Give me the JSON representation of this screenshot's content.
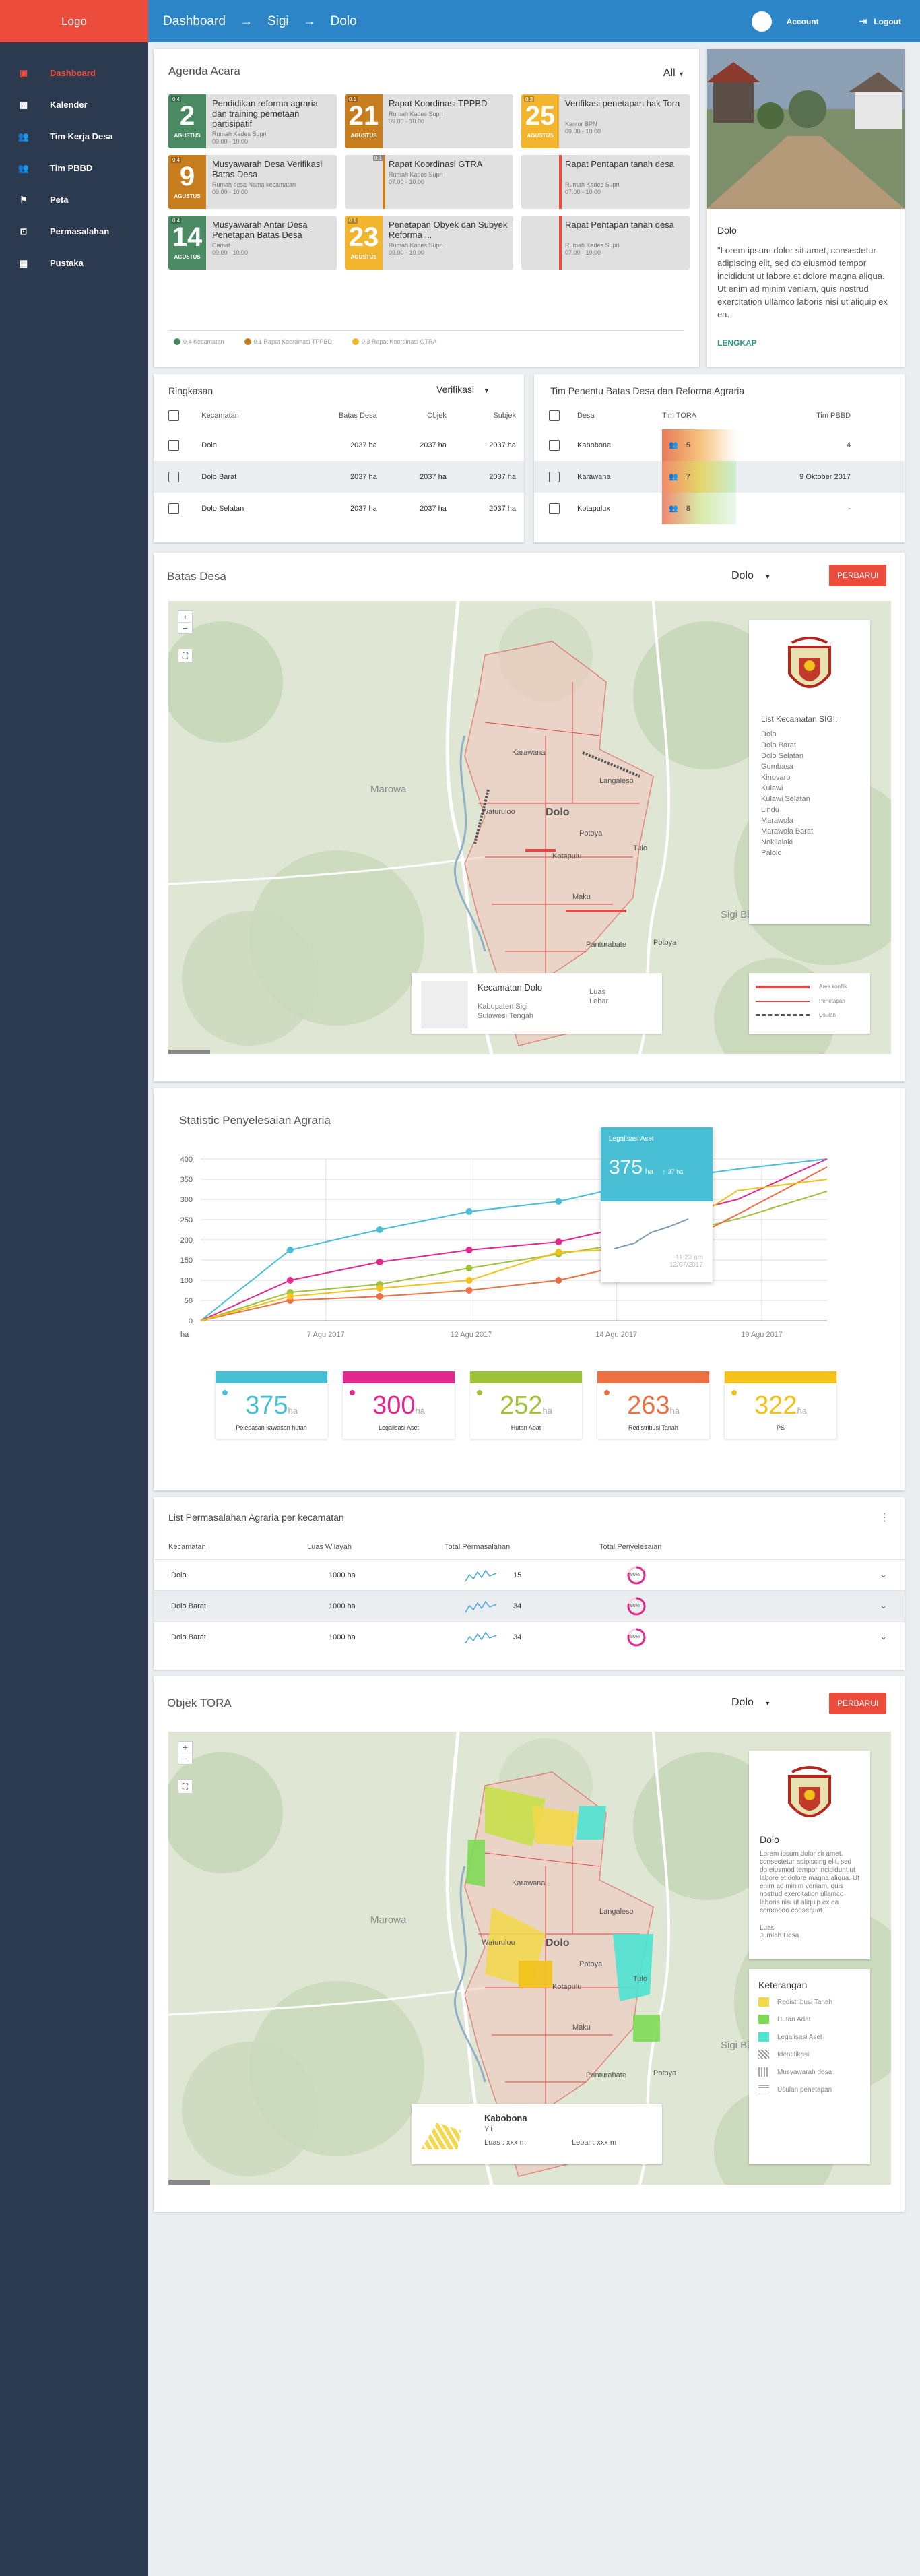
{
  "app": {
    "logo": "Logo"
  },
  "sidebar": {
    "items": [
      {
        "label": "Dashboard",
        "icon": "dashboard-icon",
        "active": true
      },
      {
        "label": "Kalender",
        "icon": "calendar-icon"
      },
      {
        "label": "Tim Kerja Desa",
        "icon": "people-icon"
      },
      {
        "label": "Tim PBBD",
        "icon": "people-icon"
      },
      {
        "label": "Peta",
        "icon": "flag-icon"
      },
      {
        "label": "Permasalahan",
        "icon": "alert-icon"
      },
      {
        "label": "Pustaka",
        "icon": "calendar-icon"
      }
    ]
  },
  "header": {
    "crumbs": [
      "Dashboard",
      "Sigi",
      "Dolo"
    ],
    "account": "Account",
    "logout": "Logout"
  },
  "agenda": {
    "title": "Agenda Acara",
    "filter": "All",
    "events": [
      {
        "day": "2",
        "month": "AGUSTUS",
        "tag": "0.4",
        "title": "Pendidikan reforma agraria dan training pemetaan partisipatif",
        "sub1": "Rumah Kades Supri",
        "sub2": "09.00 - 10.00",
        "color": "green"
      },
      {
        "day": "21",
        "month": "AGUSTUS",
        "tag": "0.1",
        "title": "Rapat Koordinasi TPPBD",
        "sub1": "Rumah Kades Supri",
        "sub2": "09.00 - 10.00",
        "color": "orange"
      },
      {
        "day": "25",
        "month": "AGUSTUS",
        "tag": "0.3",
        "title": "Verifikasi penetapan hak Tora",
        "sub1": "Kantor BPN",
        "sub2": "09.00 - 10.00",
        "color": "yellow"
      },
      {
        "day": "9",
        "month": "AGUSTUS",
        "tag": "0.4",
        "title": "Musyawarah Desa Verifikasi Batas Desa",
        "sub1": "Rumah desa Nama kecamatan",
        "sub2": "09.00 - 10.00",
        "color": "orange"
      },
      {
        "day": "",
        "month": "",
        "tag": "0.1",
        "title": "Rapat Koordinasi GTRA",
        "sub1": "Rumah Kades Supri",
        "sub2": "07.00 - 10.00",
        "color": "orange"
      },
      {
        "day": "",
        "month": "",
        "tag": "",
        "title": "Rapat Pentapan tanah desa",
        "sub1": "Rumah Kades Supri",
        "sub2": "07.00 - 10.00",
        "color": "red"
      },
      {
        "day": "14",
        "month": "AGUSTUS",
        "tag": "0.4",
        "title": "Musyawarah Antar Desa Penetapan Batas Desa",
        "sub1": "Camat",
        "sub2": "09.00 - 10.00",
        "color": "green"
      },
      {
        "day": "23",
        "month": "AGUSTUS",
        "tag": "0.1",
        "title": "Penetapan Obyek dan Subyek Reforma ...",
        "sub1": "Rumah Kades Supri",
        "sub2": "09.00 - 10.00",
        "color": "yellow"
      },
      {
        "day": "",
        "month": "",
        "tag": "",
        "title": "Rapat Pentapan tanah desa",
        "sub1": "Rumah Kades Supri",
        "sub2": "07.00 - 10.00",
        "color": "red"
      }
    ],
    "legend": [
      "0.4 Kecamatan",
      "0.1 Rapat Koordinasi TPPBD",
      "0.3 Rapat Koordinasi GTRA"
    ]
  },
  "profile": {
    "title": "Dolo",
    "text": "\"Lorem ipsum dolor sit amet, consectetur adipiscing elit, sed do eiusmod tempor incididunt ut labore et dolore magna aliqua. Ut enim ad minim veniam, quis nostrud exercitation ullamco laboris nisi ut aliquip ex ea.",
    "link": "LENGKAP"
  },
  "ringkasan": {
    "title": "Ringkasan",
    "filter": "Verifikasi",
    "headers": [
      "Kecamatan",
      "Batas Desa",
      "Objek",
      "Subjek"
    ],
    "rows": [
      [
        "Dolo",
        "2037 ha",
        "2037 ha",
        "2037 ha"
      ],
      [
        "Dolo Barat",
        "2037 ha",
        "2037 ha",
        "2037 ha"
      ],
      [
        "Dolo Selatan",
        "2037 ha",
        "2037 ha",
        "2037 ha"
      ]
    ]
  },
  "tim": {
    "title": "Tim Penentu Batas Desa dan Reforma Agraria",
    "headers": [
      "Desa",
      "Tim TORA",
      "Tim PBBD"
    ],
    "rows": [
      {
        "desa": "Kabobona",
        "tora": "5",
        "pbbd": "4"
      },
      {
        "desa": "Karawana",
        "tora": "7",
        "pbbd": "9 Oktober 2017"
      },
      {
        "desa": "Kotapulux",
        "tora": "8",
        "pbbd": "-"
      }
    ]
  },
  "batas": {
    "title": "Batas Desa",
    "select": "Dolo",
    "button": "PERBARUI",
    "labels": [
      "Karawana",
      "Langaleso",
      "Dolo",
      "Potoya",
      "Tulo",
      "Kotapulu",
      "Maku",
      "Panturabate",
      "Potoya",
      "Marowa",
      "Sigi Biromaru",
      "Waturuloo"
    ],
    "list_title": "List Kecamatan SIGI:",
    "list": [
      "Dolo",
      "Dolo Barat",
      "Dolo Selatan",
      "Gumbasa",
      "Kinovaro",
      "Kulawi",
      "Kulawi Selatan",
      "Lindu",
      "Marawola",
      "Marawola Barat",
      "Nokilalaki",
      "Palolo"
    ],
    "info": {
      "title": "Kecamatan Dolo",
      "l1": "Kabupaten Sigi",
      "l2": "Sulawesi Tengah",
      "k1": "Luas",
      "k2": "Lebar"
    },
    "legend": [
      "Area konflik",
      "Penetapan",
      "Usulan"
    ]
  },
  "stat": {
    "title": "Statistic Penyelesaian Agraria",
    "yunit": "ha",
    "tooltip": {
      "title": "Legalisasi Aset",
      "value": "375",
      "unit": "ha",
      "change": "37 ha",
      "time": "11:23 am",
      "date": "12/07/2017"
    },
    "boxes": [
      {
        "value": "375",
        "unit": "ha",
        "label": "Pelepasan kawasan hutan",
        "color": "#49bfd6"
      },
      {
        "value": "300",
        "unit": "ha",
        "label": "Legalisasi Aset",
        "color": "#e3278f"
      },
      {
        "value": "252",
        "unit": "ha",
        "label": "Hutan Adat",
        "color": "#9ec33b"
      },
      {
        "value": "263",
        "unit": "ha",
        "label": "Redistribusi Tanah",
        "color": "#ec7043"
      },
      {
        "value": "322",
        "unit": "ha",
        "label": "PS",
        "color": "#f2c21a"
      }
    ]
  },
  "chart_data": {
    "type": "line",
    "x": [
      "7 Agu 2017",
      "12 Agu 2017",
      "14 Agu 2017",
      "19 Agu 2017"
    ],
    "ylabel": "ha",
    "ylim": [
      0,
      400
    ],
    "yticks": [
      0,
      50,
      100,
      150,
      200,
      250,
      300,
      350,
      400
    ],
    "series": [
      {
        "name": "Pelepasan kawasan hutan",
        "color": "#49bfd6",
        "points": [
          [
            0,
            0
          ],
          [
            1,
            175
          ],
          [
            2,
            225
          ],
          [
            3,
            270
          ],
          [
            4,
            295
          ],
          [
            5,
            345
          ],
          [
            6,
            375
          ],
          [
            7,
            400
          ]
        ]
      },
      {
        "name": "Legalisasi Aset",
        "color": "#e3278f",
        "points": [
          [
            0,
            0
          ],
          [
            1,
            100
          ],
          [
            2,
            145
          ],
          [
            3,
            175
          ],
          [
            4,
            195
          ],
          [
            5,
            245
          ],
          [
            6,
            300
          ],
          [
            7,
            400
          ]
        ]
      },
      {
        "name": "Hutan Adat",
        "color": "#9ec33b",
        "points": [
          [
            0,
            0
          ],
          [
            1,
            70
          ],
          [
            2,
            90
          ],
          [
            3,
            130
          ],
          [
            4,
            165
          ],
          [
            5,
            200
          ],
          [
            6,
            252
          ],
          [
            7,
            320
          ]
        ]
      },
      {
        "name": "Redistribusi Tanah",
        "color": "#ec7043",
        "points": [
          [
            0,
            0
          ],
          [
            1,
            50
          ],
          [
            2,
            60
          ],
          [
            3,
            75
          ],
          [
            4,
            100
          ],
          [
            5,
            150
          ],
          [
            6,
            263
          ],
          [
            7,
            380
          ]
        ]
      },
      {
        "name": "PS",
        "color": "#f2c21a",
        "points": [
          [
            0,
            0
          ],
          [
            1,
            60
          ],
          [
            2,
            80
          ],
          [
            3,
            100
          ],
          [
            4,
            170
          ],
          [
            5,
            180
          ],
          [
            6,
            322
          ],
          [
            7,
            350
          ]
        ]
      }
    ]
  },
  "masalah": {
    "title": "List Permasalahan Agraria per kecamatan",
    "headers": [
      "Kecamatan",
      "Luas Wilayah",
      "Total Permasalahan",
      "Total Penyelesaian"
    ],
    "rows": [
      {
        "name": "Dolo",
        "luas": "1000 ha",
        "total": "15",
        "pct": "80%"
      },
      {
        "name": "Dolo Barat",
        "luas": "1000 ha",
        "total": "34",
        "pct": "80%"
      },
      {
        "name": "Dolo Barat",
        "luas": "1000 ha",
        "total": "34",
        "pct": "80%"
      }
    ]
  },
  "tora": {
    "title": "Objek TORA",
    "select": "Dolo",
    "button": "PERBARUI",
    "side_title": "Dolo",
    "side_text": "Lorem ipsum dolor sit amet, consectetur adipiscing elit, sed do eiusmod tempor incididunt ut labore et dolore magna aliqua. Ut enim ad minim veniam, quis nostrud exercitation ullamco laboris nisi ut aliquip ex ea commodo consequat.",
    "side_k1": "Luas",
    "side_k2": "Jumlah Desa",
    "ket_title": "Keterangan",
    "ket": [
      "Redistribusi Tanah",
      "Hutan Adat",
      "Legalisasi Aset",
      "Identifikasi",
      "Musyawarah desa",
      "Usulan penetapan"
    ],
    "info": {
      "title": "Kabobona",
      "sub": "Y1",
      "luas": "Luas : xxx m",
      "lebar": "Lebar : xxx m"
    }
  }
}
